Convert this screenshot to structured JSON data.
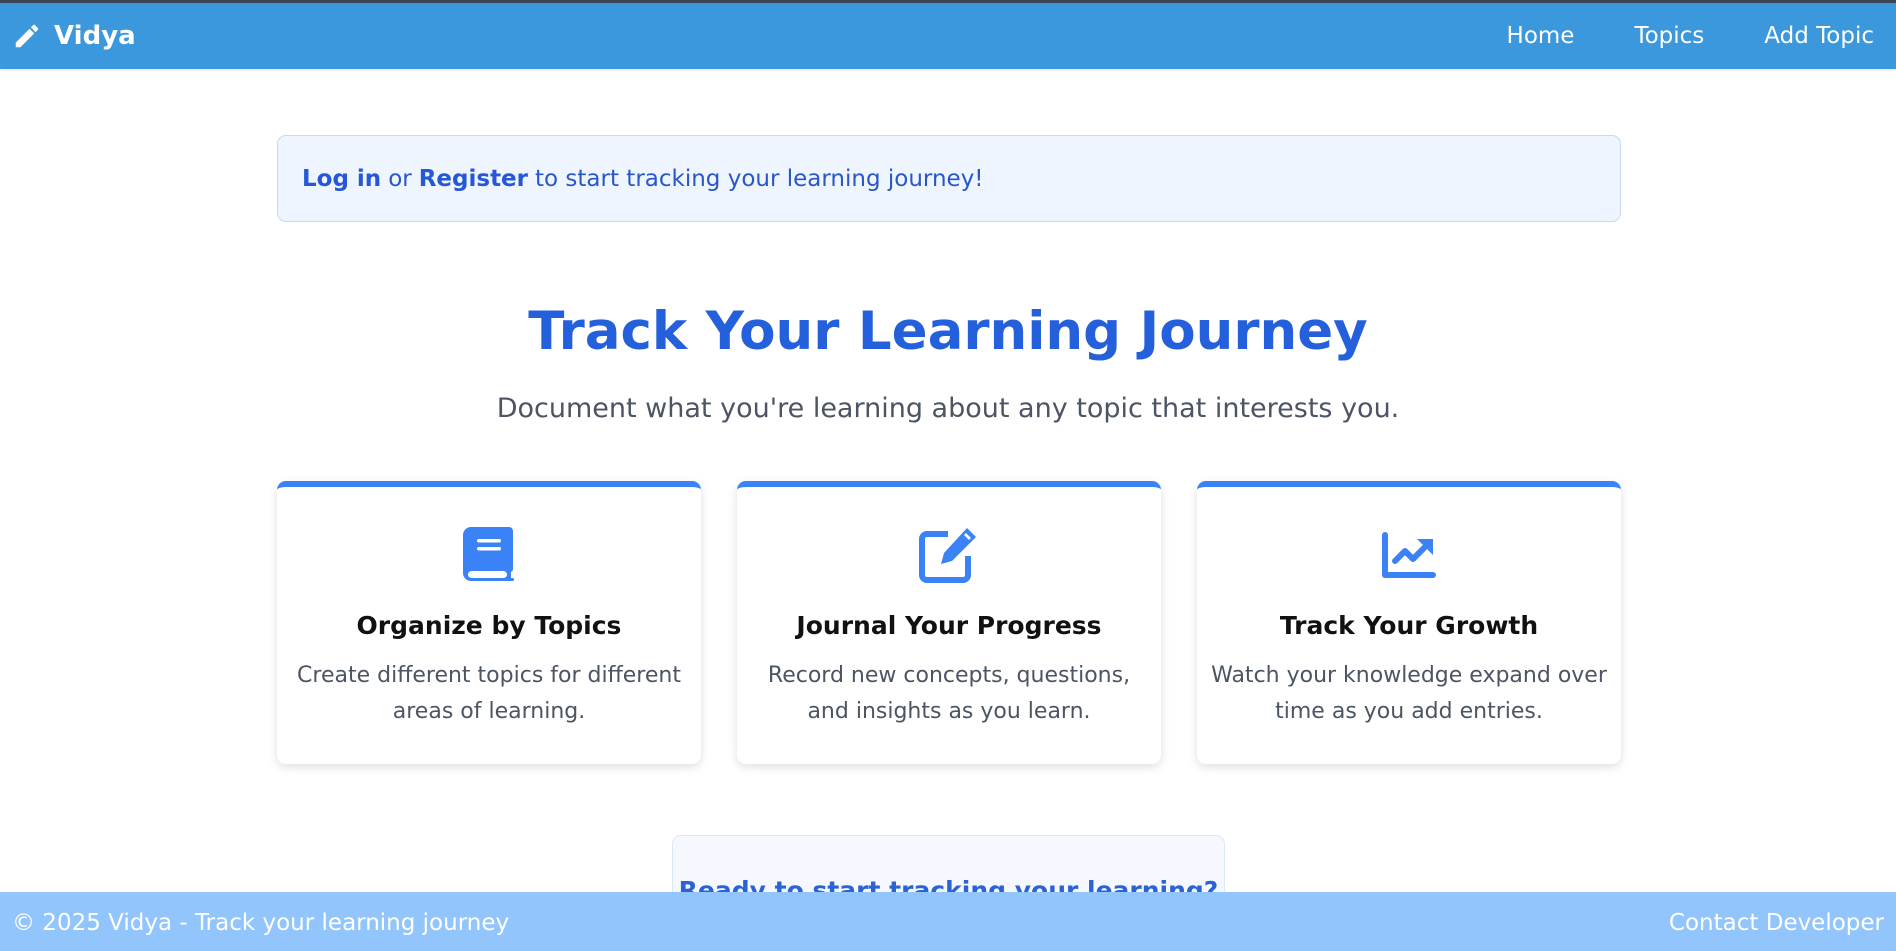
{
  "navbar": {
    "brand": "Vidya",
    "brand_icon": "pencil-icon",
    "links": [
      {
        "label": "Home"
      },
      {
        "label": "Topics"
      },
      {
        "label": "Add Topic"
      }
    ],
    "background": "#3b98dc"
  },
  "alert": {
    "login": "Log in",
    "or": "or",
    "register": "Register",
    "rest": "to start tracking your learning journey!"
  },
  "hero": {
    "title": "Track Your Learning Journey",
    "subtitle": "Document what you're learning about any topic that interests you."
  },
  "features": [
    {
      "icon": "book-icon",
      "title": "Organize by Topics",
      "description": "Create different topics for different areas of learning."
    },
    {
      "icon": "edit-icon",
      "title": "Journal Your Progress",
      "description": "Record new concepts, questions, and insights as you learn."
    },
    {
      "icon": "chart-line-icon",
      "title": "Track Your Growth",
      "description": "Watch your knowledge expand over time as you add entries."
    }
  ],
  "cta": {
    "title": "Ready to start tracking your learning?"
  },
  "footer": {
    "copyright": "© 2025 Vidya - Track your learning journey",
    "contact": "Contact Developer",
    "background": "#93c5fd"
  },
  "colors": {
    "accent": "#2560dc",
    "card_border": "#3b82f6"
  }
}
